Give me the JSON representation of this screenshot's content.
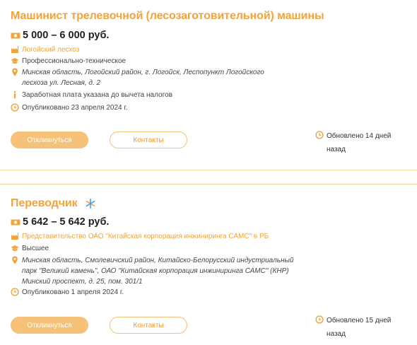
{
  "vacancies": [
    {
      "title": "Машинист трелевочной (лесозаготовительной) машины",
      "salary": "5 000 – 6 000 руб.",
      "employer": "Логойский лесхоз",
      "education": "Профессионально-техническое",
      "address": "Минская область, Логойский район, г. Логойск, Леспопункт Логойского лесхоза ул. Лесная, д. 2",
      "salary_note": "Заработная плата указана до вычета налогов",
      "published": "Опубликовано 23 апреля 2024 г.",
      "apply_label": "Откликнуться",
      "contacts_label": "Контакты",
      "updated": "Обновлено 14 дней назад"
    },
    {
      "title": "Переводчик",
      "salary": "5 642 – 5 642 руб.",
      "employer": "Представительство ОАО \"Китайская корпорация инжиниринга САМС\" в РБ",
      "education": "Высшее",
      "address": "Минская область, Смолевичский район, Китайско-Белорусский индустриальный парк \"Великий камень\", ОАО \"Китайская корпорация инжиниринга САМС\" (КНР) Минский проспект, д. 25, пом. 301/1",
      "published": "Опубликовано 1 апреля 2024 г.",
      "apply_label": "Откликнуться",
      "contacts_label": "Контакты",
      "updated": "Обновлено 15 дней назад"
    }
  ],
  "colors": {
    "accent": "#f2a33a",
    "button": "#f6c27a",
    "icon": "#f2a33a",
    "text": "#333333"
  },
  "icons": [
    "money-icon",
    "factory-icon",
    "graduation-cap-icon",
    "location-pin-icon",
    "info-icon",
    "clock-icon",
    "snowflake-badge-icon"
  ]
}
